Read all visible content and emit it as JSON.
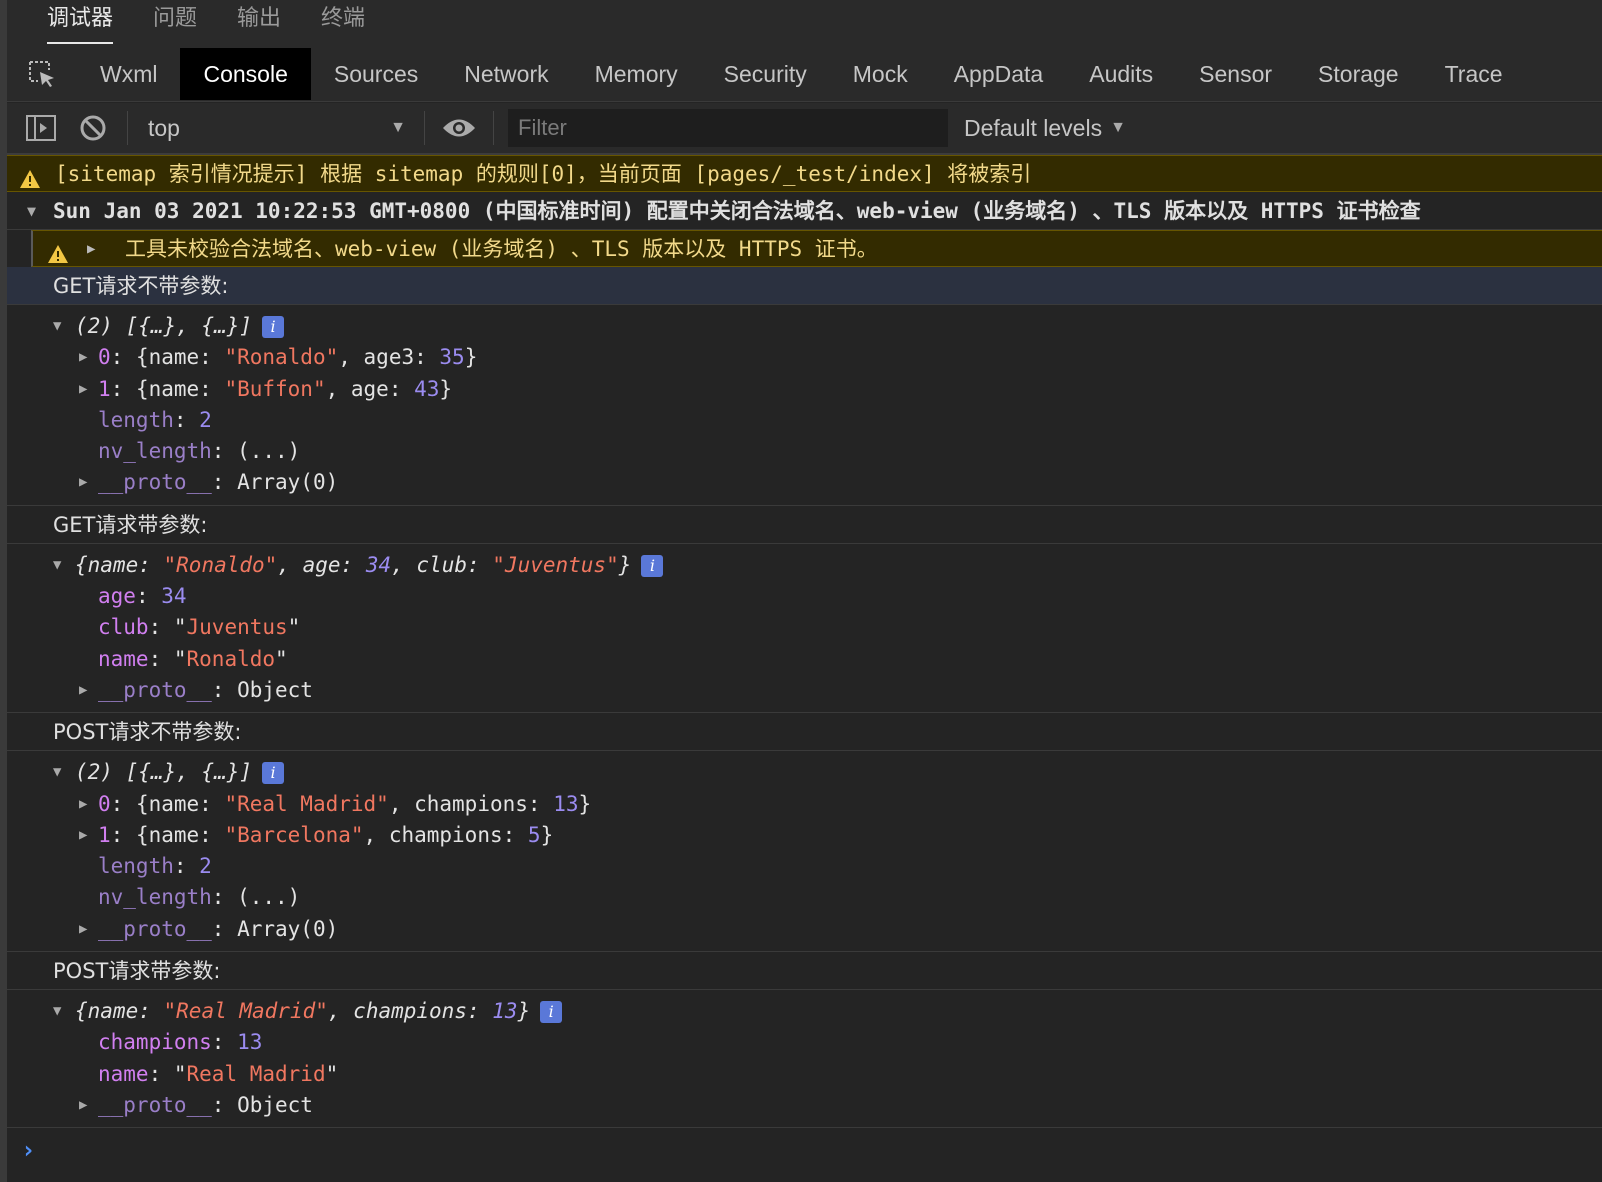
{
  "panel_tabs": [
    "调试器",
    "问题",
    "输出",
    "终端"
  ],
  "dev_tabs": [
    "Wxml",
    "Console",
    "Sources",
    "Network",
    "Memory",
    "Security",
    "Mock",
    "AppData",
    "Audits",
    "Sensor",
    "Storage",
    "Trace"
  ],
  "toolbar": {
    "context": "top",
    "filter_placeholder": "Filter",
    "levels": "Default levels"
  },
  "console": {
    "warning_sitemap": "[sitemap 索引情况提示] 根据 sitemap 的规则[0]，当前页面 [pages/_test/index] 将被索引",
    "group_header": "Sun Jan 03 2021 10:22:53 GMT+0800 (中国标准时间) 配置中关闭合法域名、web-view (业务域名) 、TLS 版本以及 HTTPS 证书检查",
    "warning_nested": "工具未校验合法域名、web-view (业务域名) 、TLS 版本以及 HTTPS 证书。",
    "label_get_no_params": "GET请求不带参数:",
    "label_get_params": "GET请求带参数:",
    "label_post_no_params": "POST请求不带参数:",
    "label_post_params": "POST请求带参数:"
  },
  "colors": {
    "background": "#242424",
    "warning_bg": "#332b00",
    "warning_text": "#f2d98a",
    "key": "#d17ff0",
    "string": "#f07760",
    "number": "#9b8cf0",
    "info_badge": "#5a78d8",
    "prompt": "#4f8ff7"
  }
}
